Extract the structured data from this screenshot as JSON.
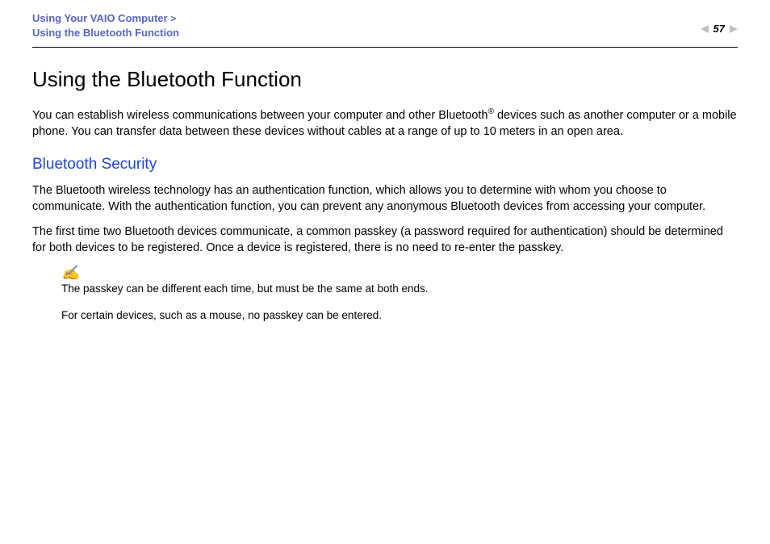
{
  "header": {
    "breadcrumb_line1_prefix": "Using Your VAIO Computer ",
    "breadcrumb_line1_chevron": ">",
    "breadcrumb_line2": "Using the Bluetooth Function",
    "page_number": "57"
  },
  "main": {
    "title": "Using the Bluetooth Function",
    "intro_part1": "You can establish wireless communications between your computer and other Bluetooth",
    "intro_reg": "®",
    "intro_part2": " devices such as another computer or a mobile phone. You can transfer data between these devices without cables at a range of up to 10 meters in an open area.",
    "subhead": "Bluetooth Security",
    "para2": "The Bluetooth wireless technology has an authentication function, which allows you to determine with whom you choose to communicate. With the authentication function, you can prevent any anonymous Bluetooth devices from accessing your computer.",
    "para3": "The first time two Bluetooth devices communicate, a common passkey (a password required for authentication) should be determined for both devices to be registered. Once a device is registered, there is no need to re-enter the passkey.",
    "note_icon": "✍",
    "note_line1": "The passkey can be different each time, but must be the same at both ends.",
    "note_line2": "For certain devices, such as a mouse, no passkey can be entered."
  }
}
